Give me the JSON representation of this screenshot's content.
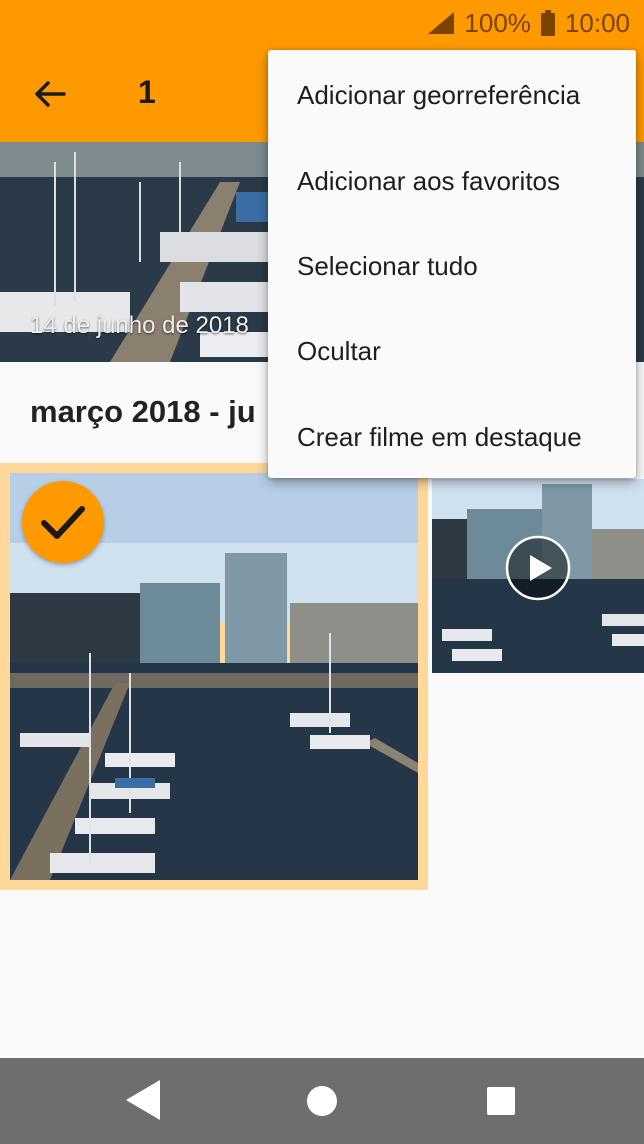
{
  "status_bar": {
    "battery_text": "100%",
    "time": "10:00"
  },
  "app_bar": {
    "selection_count": "1"
  },
  "gallery": {
    "date_label": "14 de junho de 2018",
    "section_header": "março 2018 - ju"
  },
  "menu": {
    "items": [
      "Adicionar georreferência",
      "Adicionar aos favoritos",
      "Selecionar tudo",
      "Ocultar",
      "Crear filme em destaque"
    ]
  },
  "colors": {
    "accent": "#ff9900",
    "selection_border": "#ffd89a",
    "nav_bar": "#6e6e6e"
  }
}
